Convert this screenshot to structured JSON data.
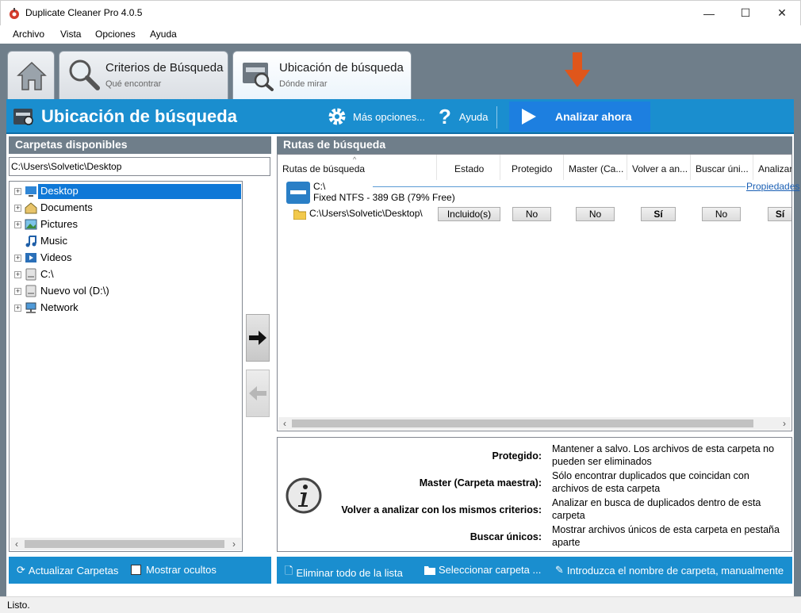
{
  "window": {
    "title": "Duplicate Cleaner Pro 4.0.5",
    "controls": {
      "minimize": "—",
      "maximize": "☐",
      "close": "✕"
    }
  },
  "menu": [
    "Archivo",
    "Vista",
    "Opciones",
    "Ayuda"
  ],
  "tabs": [
    {
      "title": "Criterios de Búsqueda",
      "subtitle": "Qué encontrar"
    },
    {
      "title": "Ubicación de búsqueda",
      "subtitle": "Dónde mirar"
    }
  ],
  "header": {
    "title": "Ubicación de búsqueda",
    "more_options": "Más opciones...",
    "help": "Ayuda",
    "analyze": "Analizar ahora"
  },
  "left_panel": {
    "title": "Carpetas disponibles",
    "path": "C:\\Users\\Solvetic\\Desktop",
    "tree": [
      {
        "label": "Desktop",
        "icon": "desktop-icon",
        "expandable": true,
        "selected": true
      },
      {
        "label": "Documents",
        "icon": "documents-icon",
        "expandable": true
      },
      {
        "label": "Pictures",
        "icon": "pictures-icon",
        "expandable": true
      },
      {
        "label": "Music",
        "icon": "music-icon",
        "expandable": false
      },
      {
        "label": "Videos",
        "icon": "videos-icon",
        "expandable": true
      },
      {
        "label": "C:\\",
        "icon": "drive-icon",
        "expandable": true
      },
      {
        "label": "Nuevo vol (D:\\)",
        "icon": "drive-icon",
        "expandable": true
      },
      {
        "label": "Network",
        "icon": "network-icon",
        "expandable": true
      }
    ],
    "refresh": "Actualizar Carpetas",
    "show_hidden": "Mostrar ocultos"
  },
  "right_panel": {
    "title": "Rutas de búsqueda",
    "columns": [
      "Rutas de búsqueda",
      "Estado",
      "Protegido",
      "Master (Ca...",
      "Volver a an...",
      "Buscar úni...",
      "Analizar"
    ],
    "drive": {
      "name": "C:\\",
      "info": "Fixed NTFS - 389 GB (79% Free)",
      "link": "Propiedades"
    },
    "row": {
      "path": "C:\\Users\\Solvetic\\Desktop\\",
      "estado": "Incluido(s)",
      "protegido": "No",
      "master": "No",
      "volver": "Sí",
      "buscar": "No",
      "analizar": "Sí"
    },
    "info": [
      {
        "key": "Protegido:",
        "value": "Mantener a salvo. Los archivos de esta carpeta no pueden ser eliminados"
      },
      {
        "key": "Master (Carpeta maestra):",
        "value": "Sólo encontrar duplicados que coincidan con archivos de esta carpeta"
      },
      {
        "key": "Volver a analizar con los mismos criterios:",
        "value": "Analizar en busca de duplicados dentro de esta carpeta"
      },
      {
        "key": "Buscar únicos:",
        "value": "Mostrar archivos únicos de esta carpeta en pestaña aparte"
      }
    ],
    "actions": {
      "remove_all": "Eliminar todo de la lista",
      "select_folder": "Seleccionar carpeta ...",
      "manual": "Introduzca el nombre de carpeta, manualmente"
    }
  },
  "status": "Listo.",
  "colors": {
    "accent": "#1a8ecf",
    "analyze": "#1d7fe0",
    "frame": "#6f7e8a",
    "selection": "#0f78d7",
    "arrow": "#e0561b"
  }
}
